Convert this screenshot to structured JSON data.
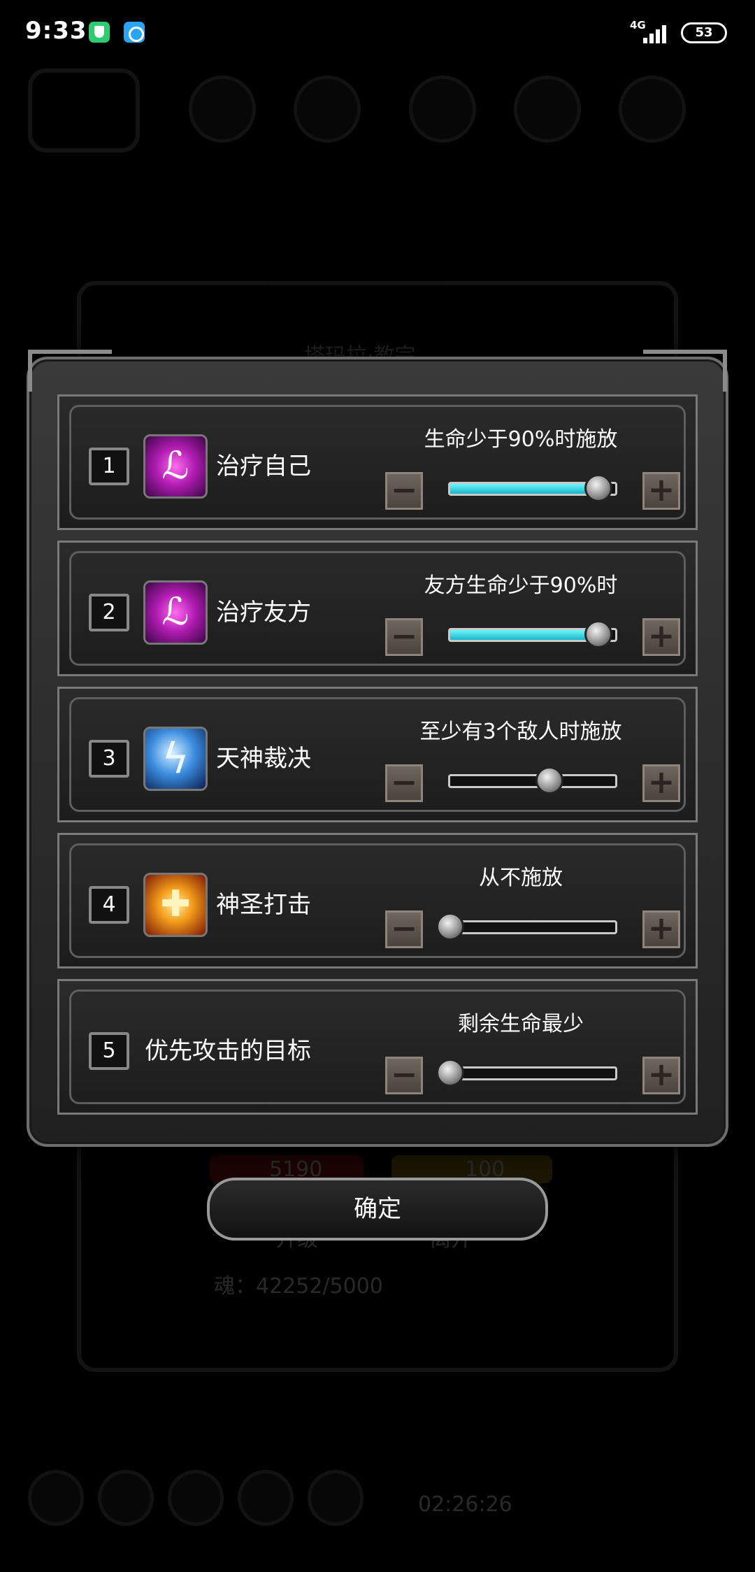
{
  "status_bar": {
    "time": "9:33",
    "network": "4G",
    "battery": "53"
  },
  "background": {
    "location_title": "塔玛拉·教宗",
    "hp_value": "5190",
    "energy_value": "100",
    "button_upgrade": "升级",
    "button_leave": "离开",
    "soul_text": "魂：42252/5000",
    "timer": "02:26:26"
  },
  "dialog": {
    "rows": [
      {
        "index": "1",
        "icon": "heal-self-skill-icon",
        "name": "治疗自己",
        "condition": "生命少于90%时施放",
        "level": 0.9,
        "filled": true
      },
      {
        "index": "2",
        "icon": "heal-ally-skill-icon",
        "name": "治疗友方",
        "condition": "友方生命少于90%时",
        "level": 0.9,
        "filled": true
      },
      {
        "index": "3",
        "icon": "divine-judgment-skill-icon",
        "name": "天神裁决",
        "condition": "至少有3个敌人时施放",
        "level": 0.6,
        "filled": false
      },
      {
        "index": "4",
        "icon": "holy-strike-skill-icon",
        "name": "神圣打击",
        "condition": "从不施放",
        "level": 0.0,
        "filled": false
      },
      {
        "index": "5",
        "icon": "",
        "name": "优先攻击的目标",
        "condition": "剩余生命最少",
        "level": 0.0,
        "filled": false
      }
    ],
    "minus_symbol": "−",
    "plus_symbol": "+",
    "confirm_label": "确定"
  },
  "colors": {
    "slider_fill": "#1ab5c6",
    "panel": "#1c1c1c"
  }
}
